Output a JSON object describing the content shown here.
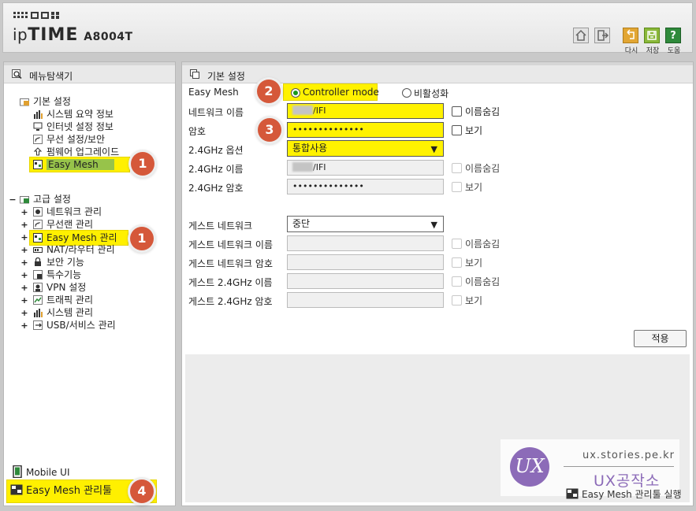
{
  "header": {
    "logo_ip": "ip",
    "logo_time": "TIME",
    "model": "A8004T",
    "toolbar": {
      "undo_label": "다시",
      "save_label": "저장",
      "help_label": "도움"
    }
  },
  "menu_panel": {
    "title": "메뉴탐색기",
    "basic": {
      "label": "기본 설정",
      "items": [
        "시스템 요약 정보",
        "인터넷 설정 정보",
        "무선 설정/보안",
        "펌웨어 업그레이드",
        "Easy Mesh"
      ]
    },
    "advanced": {
      "label": "고급 설정",
      "items": [
        "네트워크 관리",
        "무선랜 관리",
        "Easy Mesh 관리",
        "NAT/라우터 관리",
        "보안 기능",
        "특수기능",
        "VPN 설정",
        "트래픽 관리",
        "시스템 관리",
        "USB/서비스 관리"
      ]
    },
    "mobile_ui": "Mobile UI",
    "easymesh_tool": "Easy Mesh 관리툴"
  },
  "settings_panel": {
    "title": "기본 설정",
    "easy_mesh_label": "Easy Mesh",
    "mode_options": [
      "Controller mode",
      "비활성화"
    ],
    "network_name_label": "네트워크 이름",
    "network_name_value": "/IFI",
    "password_label": "암호",
    "password_value": "••••••••••••••",
    "band_option_label": "2.4GHz 옵션",
    "band_option_value": "통합사용",
    "name_24_label": "2.4GHz 이름",
    "name_24_value": "/IFI",
    "password_24_label": "2.4GHz 암호",
    "password_24_value": "••••••••••••••",
    "hide_name_label": "이름숨김",
    "show_label": "보기",
    "guest_network_label": "게스트 네트워크",
    "guest_network_value": "중단",
    "guest_name_label": "게스트 네트워크 이름",
    "guest_password_label": "게스트 네트워크 암호",
    "guest_24_name_label": "게스트 2.4GHz 이름",
    "guest_24_password_label": "게스트 2.4GHz 암호",
    "apply_label": "적용"
  },
  "badges": [
    "1",
    "1",
    "2",
    "3",
    "4"
  ],
  "watermark": {
    "logo": "UX",
    "url": "ux.stories.pe.kr",
    "title": "UX공작소",
    "run_label": "Easy Mesh 관리툴 실행"
  },
  "colors": {
    "highlight": "#fff000",
    "badge": "#d5583a",
    "brand": "#8c6bb8",
    "radio_on": "#1a9a1a"
  }
}
